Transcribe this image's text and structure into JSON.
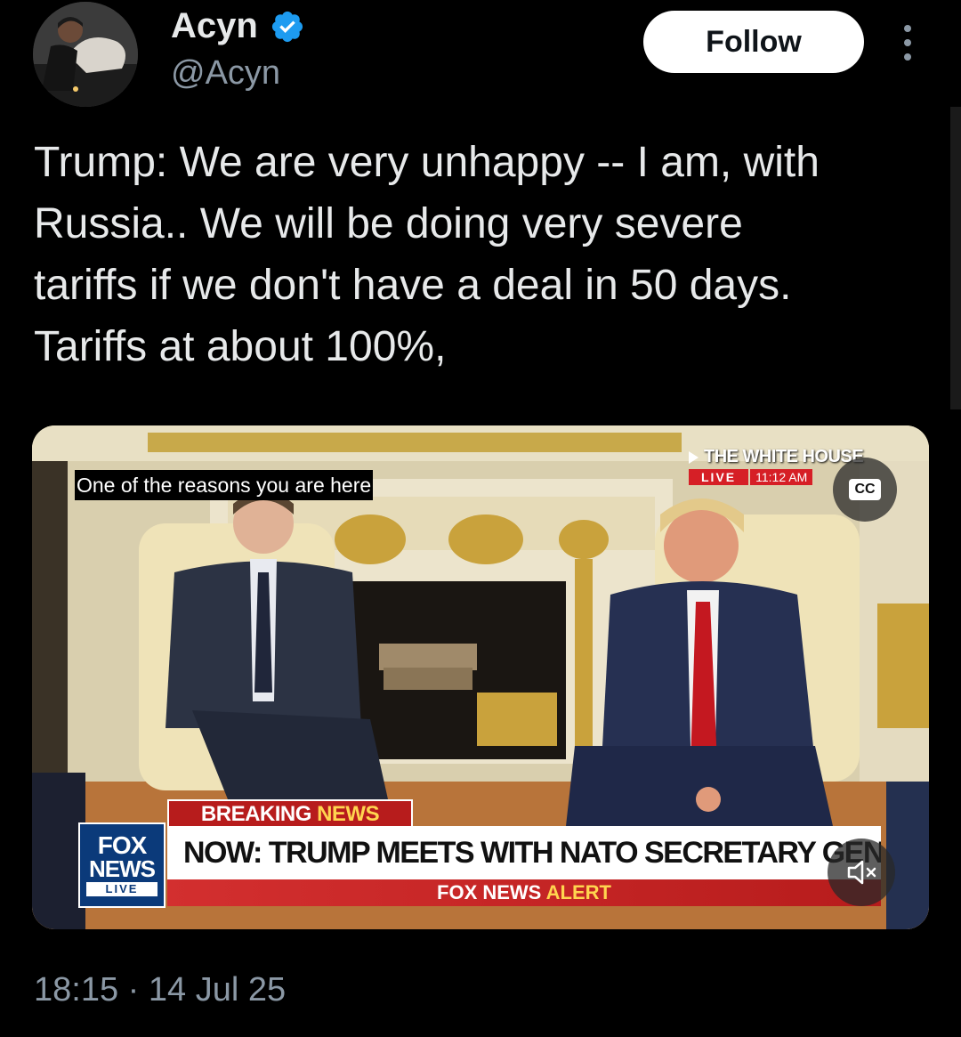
{
  "author": {
    "display_name": "Acyn",
    "handle": "@Acyn",
    "verified": true
  },
  "follow_label": "Follow",
  "tweet": {
    "text": "Trump: We are very unhappy -- I am, with\nRussia.. We will be doing very severe\ntariffs if we don't have a deal in 50 days.\nTariffs at about 100%,"
  },
  "video": {
    "caption": "One of the reasons you are here",
    "source_label": "THE WHITE HOUSE",
    "live_label": "LIVE",
    "time_label": "11:12 AM",
    "cc_label": "CC",
    "breaking_prefix": "BREAKING",
    "breaking_news_word": "NEWS",
    "fox_logo_line1": "FOX",
    "fox_logo_line2": "NEWS",
    "fox_logo_line3": "LIVE",
    "headline": "NOW: TRUMP MEETS WITH NATO SECRETARY GENERAL",
    "alert_prefix": "FOX NEWS",
    "alert_word": "ALERT",
    "mute_icon": "speaker-muted-icon"
  },
  "timestamp": "18:15 · 14 Jul 25",
  "colors": {
    "background": "#000000",
    "text_primary": "#e7e9ea",
    "text_secondary": "#8b98a5",
    "verified_blue": "#1d9bf0",
    "fox_red": "#b71c1c",
    "fox_blue": "#0b3a7a"
  }
}
